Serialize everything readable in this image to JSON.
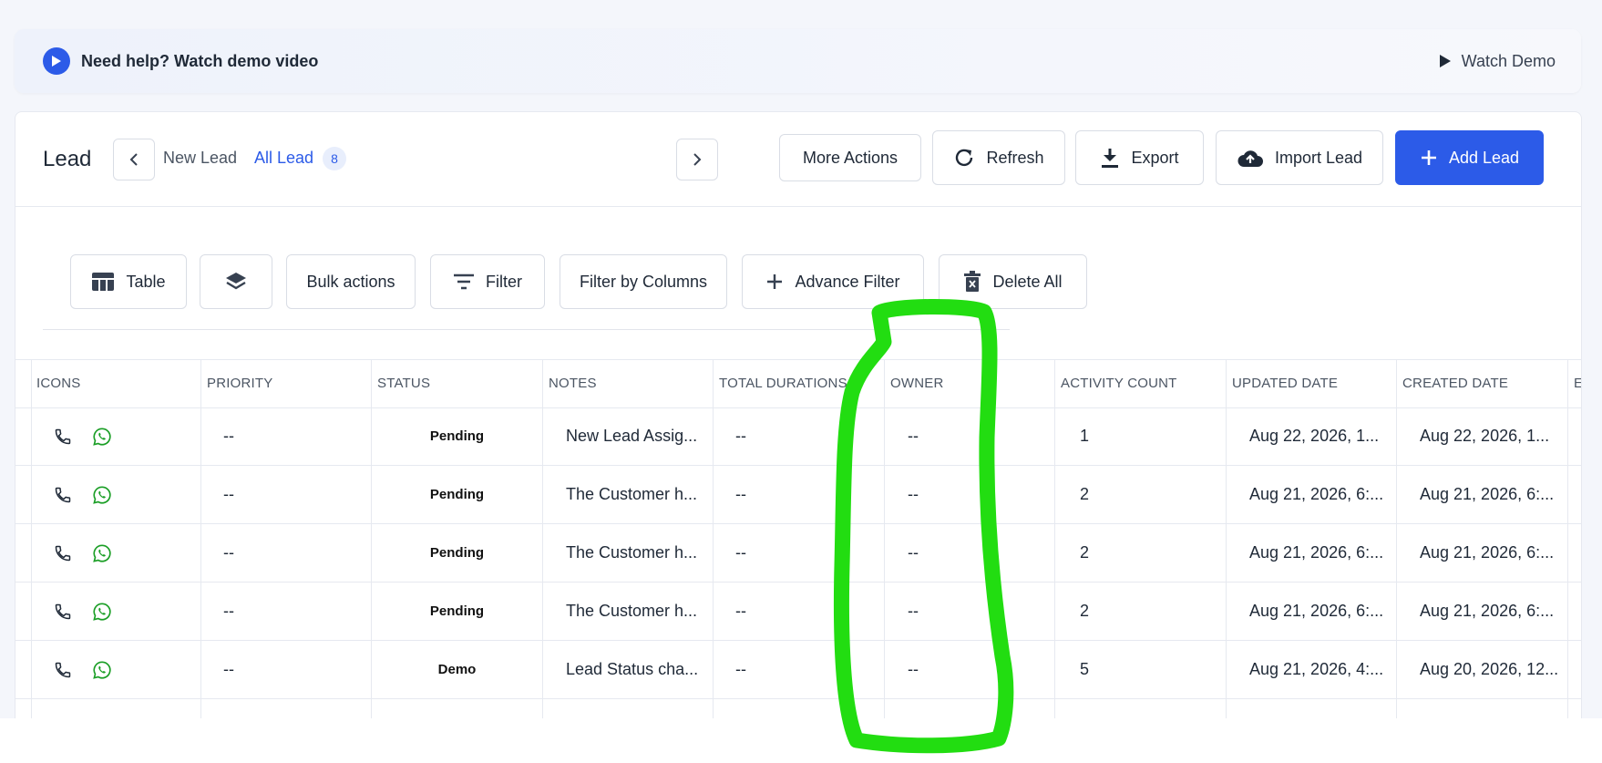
{
  "banner": {
    "help_text": "Need help? Watch demo video",
    "watch_demo": "Watch Demo"
  },
  "header": {
    "title": "Lead",
    "tabs": [
      {
        "label": "New Lead"
      },
      {
        "label": "All Lead",
        "count": "8",
        "active": true
      }
    ],
    "buttons": {
      "more_actions": "More Actions",
      "refresh": "Refresh",
      "export": "Export",
      "import": "Import Lead",
      "add": "Add Lead"
    }
  },
  "toolbar": {
    "table": "Table",
    "bulk_actions": "Bulk actions",
    "filter": "Filter",
    "filter_by_columns": "Filter by Columns",
    "advance_filter": "Advance Filter",
    "delete_all": "Delete All"
  },
  "table": {
    "columns": [
      "ICONS",
      "PRIORITY",
      "STATUS",
      "NOTES",
      "TOTAL DURATIONS",
      "OWNER",
      "ACTIVITY COUNT",
      "UPDATED DATE",
      "CREATED DATE",
      "E"
    ],
    "rows": [
      {
        "priority": "--",
        "status": "Pending",
        "notes": "New Lead Assig...",
        "total_durations": "--",
        "owner": "--",
        "activity_count": "1",
        "updated": "Aug 22, 2026, 1...",
        "created": "Aug 22, 2026, 1..."
      },
      {
        "priority": "--",
        "status": "Pending",
        "notes": "The Customer h...",
        "total_durations": "--",
        "owner": "--",
        "activity_count": "2",
        "updated": "Aug 21, 2026, 6:...",
        "created": "Aug 21, 2026, 6:..."
      },
      {
        "priority": "--",
        "status": "Pending",
        "notes": "The Customer h...",
        "total_durations": "--",
        "owner": "--",
        "activity_count": "2",
        "updated": "Aug 21, 2026, 6:...",
        "created": "Aug 21, 2026, 6:..."
      },
      {
        "priority": "--",
        "status": "Pending",
        "notes": "The Customer h...",
        "total_durations": "--",
        "owner": "--",
        "activity_count": "2",
        "updated": "Aug 21, 2026, 6:...",
        "created": "Aug 21, 2026, 6:..."
      },
      {
        "priority": "--",
        "status": "Demo",
        "notes": "Lead Status cha...",
        "total_durations": "--",
        "owner": "--",
        "activity_count": "5",
        "updated": "Aug 21, 2026, 4:...",
        "created": "Aug 20, 2026, 12..."
      }
    ]
  },
  "colors": {
    "accent": "#2c5be8",
    "annotation": "#22dd11",
    "whatsapp": "#1a9e25"
  }
}
